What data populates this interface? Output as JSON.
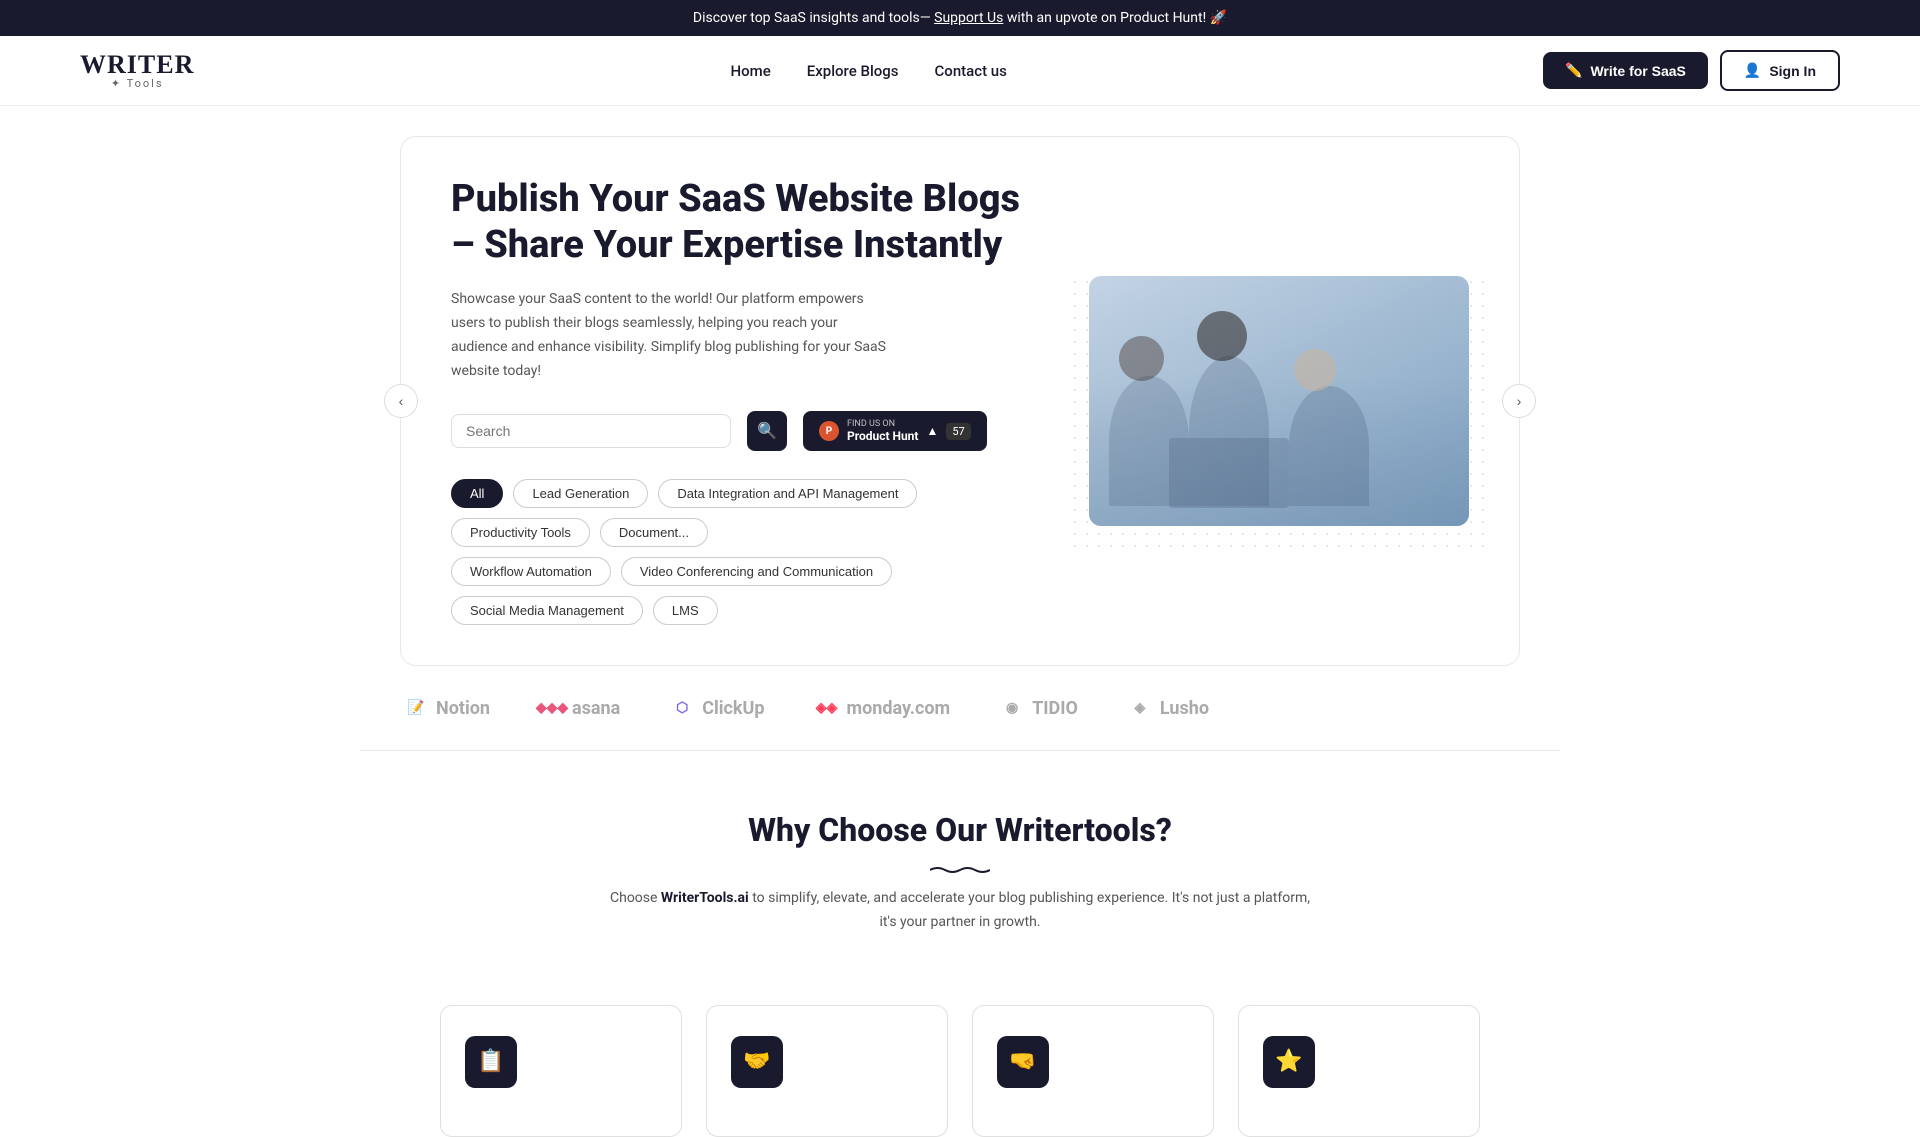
{
  "banner": {
    "text": "Discover top SaaS insights and tools—",
    "link_text": "Support Us",
    "suffix": " with an upvote on Product Hunt! 🚀"
  },
  "nav": {
    "logo_writer": "WRITER",
    "logo_tools": "✦ Tools",
    "links": [
      {
        "label": "Home",
        "href": "#"
      },
      {
        "label": "Explore Blogs",
        "href": "#"
      },
      {
        "label": "Contact us",
        "href": "#"
      }
    ],
    "write_btn": "Write for SaaS",
    "signin_btn": "Sign In"
  },
  "hero": {
    "title": "Publish Your SaaS Website Blogs – Share Your Expertise Instantly",
    "description": "Showcase your SaaS content to the world! Our platform empowers users to publish their blogs seamlessly, helping you reach your audience and enhance visibility. Simplify blog publishing for your SaaS website today!",
    "search_placeholder": "Search",
    "ph_label": "FIND US ON",
    "ph_product": "Product Hunt",
    "ph_count": "57"
  },
  "filters": {
    "row1": [
      {
        "label": "All",
        "active": true
      },
      {
        "label": "Lead Generation",
        "active": false
      },
      {
        "label": "Data Integration and API Management",
        "active": false
      },
      {
        "label": "Productivity Tools",
        "active": false
      },
      {
        "label": "Document...",
        "active": false
      }
    ],
    "row2": [
      {
        "label": "Workflow Automation",
        "active": false
      },
      {
        "label": "Video Conferencing and Communication",
        "active": false
      },
      {
        "label": "Social Media Management",
        "active": false
      },
      {
        "label": "LMS",
        "active": false
      }
    ]
  },
  "brands": [
    {
      "name": "Notion",
      "icon": "📝"
    },
    {
      "name": "asana",
      "icon": "◆"
    },
    {
      "name": "ClickUp",
      "icon": "⬡"
    },
    {
      "name": "monday.com",
      "icon": "◈"
    },
    {
      "name": "TIDIO",
      "icon": "◉"
    },
    {
      "name": "Lusho",
      "icon": "◈"
    }
  ],
  "why": {
    "title": "Why Choose Our Writertools?",
    "brand_name": "WriterTools.ai",
    "description_before": "Choose ",
    "description_after": " to simplify, elevate, and accelerate your blog publishing experience. It's not just a platform, it's your partner in growth."
  },
  "feature_cards": [
    {
      "icon": "📋",
      "id": "card-1"
    },
    {
      "icon": "🤝",
      "id": "card-2"
    },
    {
      "icon": "🤜",
      "id": "card-3"
    },
    {
      "icon": "⭐",
      "id": "card-4"
    }
  ]
}
